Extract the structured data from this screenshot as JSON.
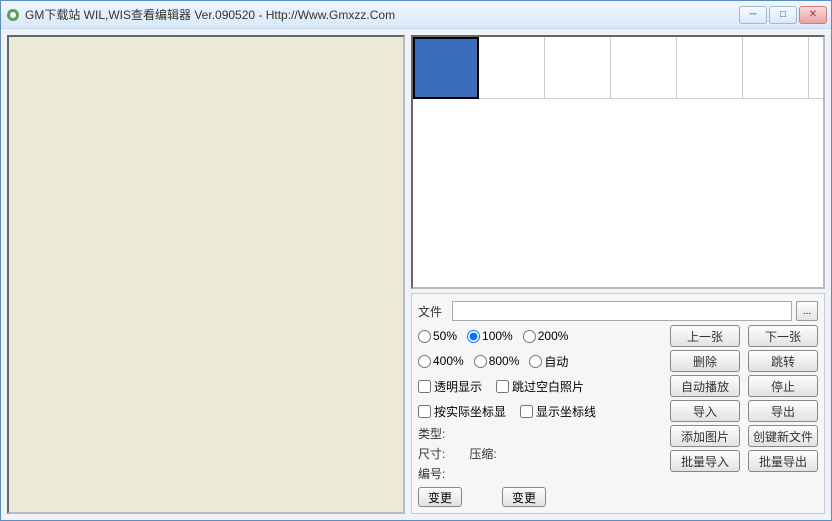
{
  "window": {
    "title": "GM下载站  WIL,WIS查看编辑器  Ver.090520    - Http://Www.Gmxzz.Com"
  },
  "controls": {
    "file_label": "文件",
    "file_value": "",
    "browse": "...",
    "zoom": {
      "z50": "50%",
      "z100": "100%",
      "z200": "200%",
      "z400": "400%",
      "z800": "800%",
      "auto": "自动"
    },
    "checks": {
      "transparent": "透明显示",
      "skip_blank": "跳过空白照片",
      "real_coord": "按实际坐标显",
      "show_coord": "显示坐标线"
    },
    "info": {
      "type_label": "类型:",
      "size_label": "尺寸:",
      "compress_label": "压缩:",
      "id_label": "编号:"
    },
    "change": "变更"
  },
  "buttons": {
    "prev": "上一张",
    "next": "下一张",
    "delete": "删除",
    "jump": "跳转",
    "autoplay": "自动播放",
    "stop": "停止",
    "import": "导入",
    "export": "导出",
    "add_image": "添加图片",
    "new_file": "创键新文件",
    "batch_import": "批量导入",
    "batch_export": "批量导出"
  }
}
